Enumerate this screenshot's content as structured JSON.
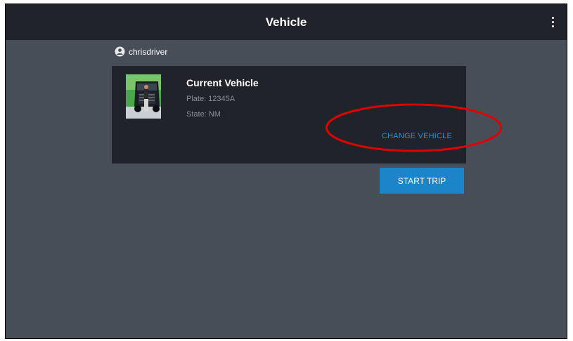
{
  "header": {
    "title": "Vehicle",
    "menu_icon": "more-vert-icon"
  },
  "user": {
    "name": "chrisdriver",
    "icon": "account-circle-icon"
  },
  "current_vehicle": {
    "heading": "Current Vehicle",
    "plate": "Plate: 12345A",
    "state": "State: NM",
    "change_label": "CHANGE VEHICLE"
  },
  "actions": {
    "start_trip_label": "START TRIP"
  },
  "colors": {
    "background": "#474e57",
    "bar": "#20242a",
    "accent": "#1a86c9",
    "link": "#2d8fd5",
    "highlight": "#e00000"
  }
}
